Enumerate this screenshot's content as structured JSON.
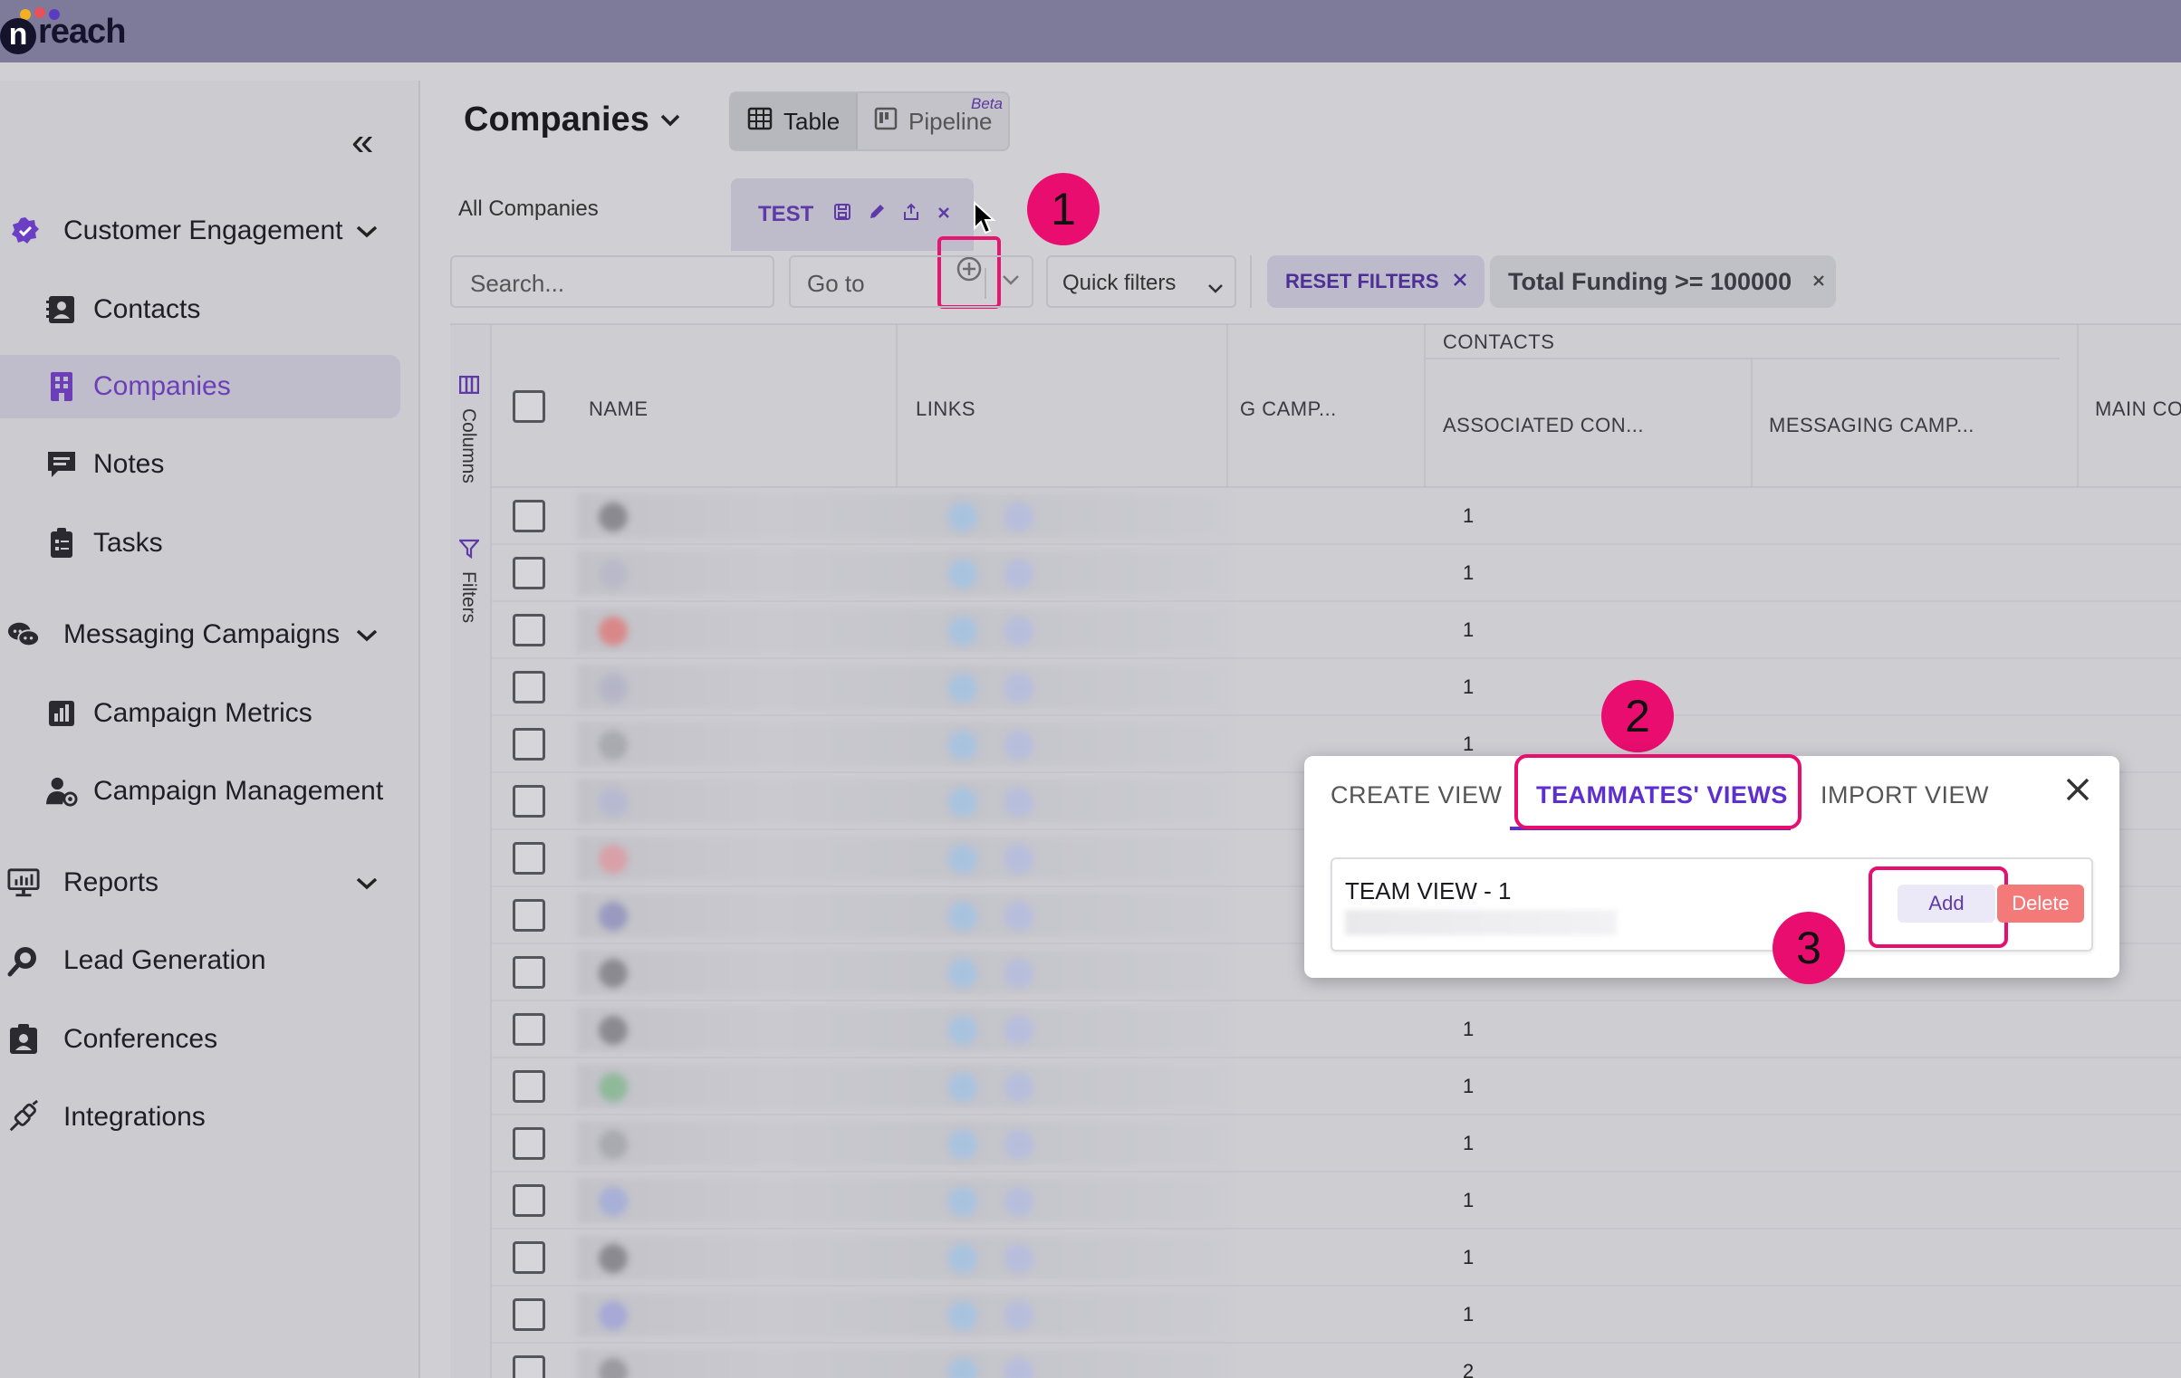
{
  "app": {
    "logo_initial": "n",
    "logo_text": "reach"
  },
  "sidebar": {
    "collapse_icon": "«",
    "items": [
      {
        "label": "Customer Engagement",
        "icon": "badge-check-icon",
        "group": true
      },
      {
        "label": "Contacts",
        "icon": "contact-card-icon"
      },
      {
        "label": "Companies",
        "icon": "building-icon",
        "active": true
      },
      {
        "label": "Notes",
        "icon": "note-icon"
      },
      {
        "label": "Tasks",
        "icon": "clipboard-icon"
      },
      {
        "label": "Messaging Campaigns",
        "icon": "chat-bubbles-icon",
        "group": true
      },
      {
        "label": "Campaign Metrics",
        "icon": "bar-chart-icon"
      },
      {
        "label": "Campaign Management",
        "icon": "user-gear-icon"
      },
      {
        "label": "Reports",
        "icon": "monitor-chart-icon",
        "group": true
      },
      {
        "label": "Lead Generation",
        "icon": "magnifier-icon"
      },
      {
        "label": "Conferences",
        "icon": "badge-person-icon"
      },
      {
        "label": "Integrations",
        "icon": "plug-icon"
      }
    ]
  },
  "header": {
    "title": "Companies",
    "view_toggle": {
      "table": "Table",
      "pipeline": "Pipeline",
      "beta": "Beta"
    }
  },
  "tabs": {
    "all": "All Companies",
    "current": "TEST"
  },
  "filters": {
    "search_placeholder": "Search...",
    "goto_label": "Go to",
    "quick_label": "Quick filters",
    "reset_label": "RESET FILTERS",
    "active_filter": "Total Funding >= 100000"
  },
  "grid": {
    "side_columns_label": "Columns",
    "side_filters_label": "Filters",
    "group_header": "CONTACTS",
    "headers": {
      "name": "NAME",
      "links": "LINKS",
      "camp": "G CAMP...",
      "associated": "ASSOCIATED CON...",
      "messaging": "MESSAGING CAMP...",
      "main": "MAIN CONTA"
    },
    "associated_counts": [
      "1",
      "1",
      "1",
      "1",
      "1",
      "",
      "",
      "",
      "",
      "1",
      "1",
      "1",
      "1",
      "1",
      "1",
      "2"
    ]
  },
  "modal": {
    "tabs": [
      "CREATE VIEW",
      "TEAMMATES' VIEWS",
      "IMPORT VIEW"
    ],
    "active_tab": 1,
    "view_name": "TEAM VIEW - 1",
    "add_label": "Add",
    "delete_label": "Delete"
  },
  "annotations": [
    "1",
    "2",
    "3"
  ],
  "colors": {
    "accent": "#5e2fcf",
    "highlight": "#e80d6f",
    "topbar": "#7e7a99",
    "danger": "#f47a7a"
  }
}
